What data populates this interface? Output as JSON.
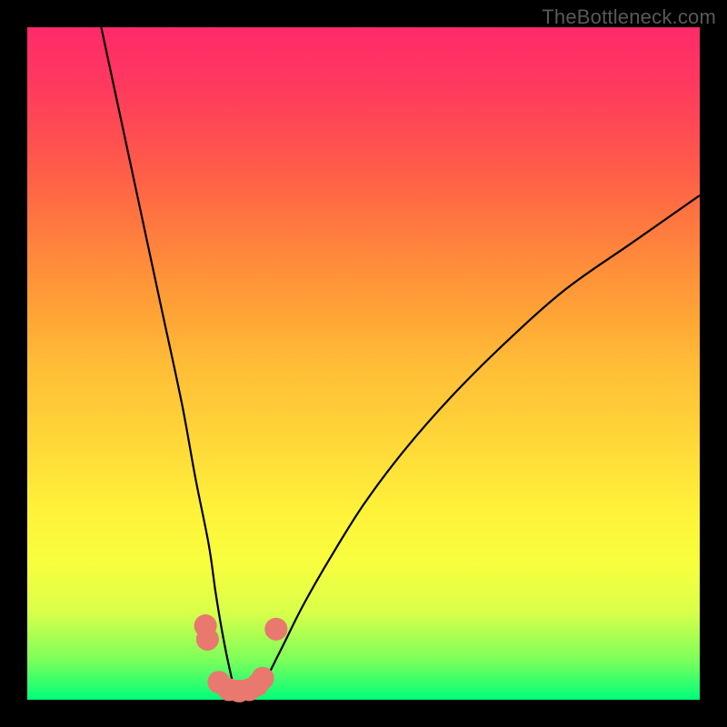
{
  "watermark": "TheBottleneck.com",
  "colors": {
    "frame": "#000000",
    "gradient_top": "#ff2a6a",
    "gradient_bottom": "#00ff7a",
    "curve": "#000000",
    "markers": "#e9786f"
  },
  "chart_data": {
    "type": "line",
    "title": "",
    "xlabel": "",
    "ylabel": "",
    "xlim": [
      0,
      100
    ],
    "ylim": [
      0,
      100
    ],
    "note": "No axis ticks or labels are shown in the image; x and y are normalized 0-100 within the plot area. The curve is a V-shaped valley with minimum near x≈31 reaching y≈0, rising steeply to y≈100 at x≈11 on the left and gradually to y≈75 at x=100 on the right. Marker dots cluster near the valley floor.",
    "series": [
      {
        "name": "curve",
        "x": [
          11,
          14,
          17,
          20,
          23,
          25,
          27,
          28,
          29,
          30,
          31,
          32,
          33,
          34,
          35,
          36,
          38,
          41,
          45,
          50,
          56,
          63,
          71,
          80,
          90,
          100
        ],
        "y": [
          100,
          86,
          72,
          58,
          44,
          33,
          23,
          16,
          10,
          5,
          1,
          0,
          0,
          1,
          2,
          4,
          8,
          14,
          21,
          29,
          37,
          45,
          53,
          61,
          68,
          75
        ]
      }
    ],
    "markers": [
      {
        "x": 26.5,
        "y": 11.0,
        "r": 1.5
      },
      {
        "x": 26.8,
        "y": 9.0,
        "r": 1.5
      },
      {
        "x": 28.5,
        "y": 2.6,
        "r": 1.5
      },
      {
        "x": 30.0,
        "y": 1.5,
        "r": 1.5
      },
      {
        "x": 31.5,
        "y": 1.3,
        "r": 1.5
      },
      {
        "x": 33.0,
        "y": 1.5,
        "r": 1.5
      },
      {
        "x": 34.2,
        "y": 2.2,
        "r": 1.5
      },
      {
        "x": 35.0,
        "y": 3.2,
        "r": 1.5
      },
      {
        "x": 37.0,
        "y": 10.5,
        "r": 1.5
      }
    ]
  }
}
